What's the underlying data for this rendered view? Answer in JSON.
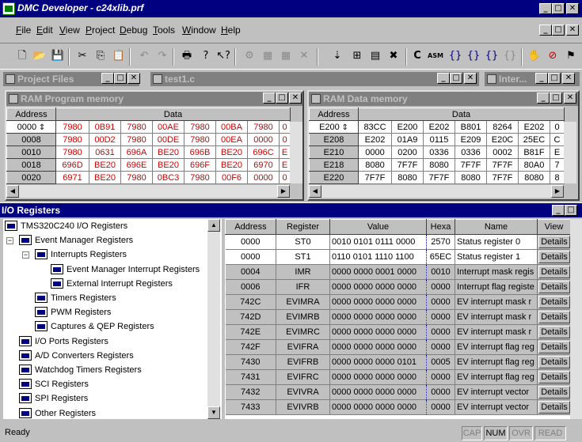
{
  "window": {
    "title": "DMC Developer - c24xlib.prf"
  },
  "menu": [
    "File",
    "Edit",
    "View",
    "Project",
    "Debug",
    "Tools",
    "Window",
    "Help"
  ],
  "toolbar": {
    "c_label": "C",
    "asm_label": "ASM"
  },
  "panes": {
    "project_files": "Project Files",
    "test": "test1.c",
    "inter": "Inter..."
  },
  "program_memory": {
    "title": "RAM Program memory",
    "headers": {
      "address": "Address",
      "data": "Data"
    },
    "addr_input": "0000",
    "rows": [
      {
        "addr": "",
        "vals": [
          "7980",
          "0B91",
          "7980",
          "00AE",
          "7980",
          "00BA",
          "7980",
          "0"
        ]
      },
      {
        "addr": "0008",
        "vals": [
          "7980",
          "00D2",
          "7980",
          "00DE",
          "7980",
          "00EA",
          "0000",
          "0"
        ]
      },
      {
        "addr": "0010",
        "vals": [
          "7980",
          "0631",
          "696A",
          "BE20",
          "696B",
          "BE20",
          "696C",
          "E"
        ]
      },
      {
        "addr": "0018",
        "vals": [
          "696D",
          "BE20",
          "696E",
          "BE20",
          "696F",
          "BE20",
          "6970",
          "E"
        ]
      },
      {
        "addr": "0020",
        "vals": [
          "6971",
          "BE20",
          "7980",
          "0BC3",
          "7980",
          "00F6",
          "0000",
          "0"
        ]
      }
    ]
  },
  "data_memory": {
    "title": "RAM Data memory",
    "headers": {
      "address": "Address",
      "data": "Data"
    },
    "addr_input": "E200",
    "rows": [
      {
        "addr": "",
        "vals": [
          "83CC",
          "E200",
          "E202",
          "B801",
          "8264",
          "E202",
          "0"
        ]
      },
      {
        "addr": "E208",
        "vals": [
          "E202",
          "01A9",
          "0115",
          "E209",
          "E20C",
          "25EC",
          "C"
        ]
      },
      {
        "addr": "E210",
        "vals": [
          "0000",
          "0200",
          "0336",
          "0336",
          "0002",
          "B81F",
          "E"
        ]
      },
      {
        "addr": "E218",
        "vals": [
          "8080",
          "7F7F",
          "8080",
          "7F7F",
          "7F7F",
          "80A0",
          "7"
        ]
      },
      {
        "addr": "E220",
        "vals": [
          "7F7F",
          "8080",
          "7F7F",
          "8080",
          "7F7F",
          "8080",
          "8"
        ]
      }
    ]
  },
  "io": {
    "title": "I/O Registers",
    "tree": [
      {
        "label": "TMS320C240 I/O Registers",
        "level": 0
      },
      {
        "label": "Event Manager Registers",
        "level": 1
      },
      {
        "label": "Interrupts Registers",
        "level": 2
      },
      {
        "label": "Event Manager Interrupt Registers",
        "level": 3
      },
      {
        "label": "External Interrupt Registers",
        "level": 3
      },
      {
        "label": "Timers Registers",
        "level": 2
      },
      {
        "label": "PWM Registers",
        "level": 2
      },
      {
        "label": "Captures & QEP Registers",
        "level": 2
      },
      {
        "label": "I/O Ports Registers",
        "level": 1
      },
      {
        "label": "A/D Converters Registers",
        "level": 1
      },
      {
        "label": "Watchdog Timers Registers",
        "level": 1
      },
      {
        "label": "SCI Registers",
        "level": 1
      },
      {
        "label": "SPI Registers",
        "level": 1
      },
      {
        "label": "Other Registers",
        "level": 1
      }
    ],
    "headers": {
      "address": "Address",
      "register": "Register",
      "value": "Value",
      "hexa": "Hexa",
      "name": "Name",
      "view": "View"
    },
    "details_label": "Details",
    "rows": [
      {
        "address": "0000",
        "register": "ST0",
        "value": "0010 0101 0111 0000",
        "hexa": "2570",
        "name": "Status register 0"
      },
      {
        "address": "0000",
        "register": "ST1",
        "value": "0110 0101 1110 1100",
        "hexa": "65EC",
        "name": "Status register 1"
      },
      {
        "address": "0004",
        "register": "IMR",
        "value": "0000 0000 0001 0000",
        "hexa": "0010",
        "name": "Interrupt mask regis"
      },
      {
        "address": "0006",
        "register": "IFR",
        "value": "0000 0000 0000 0000",
        "hexa": "0000",
        "name": "Interrupt flag registe"
      },
      {
        "address": "742C",
        "register": "EVIMRA",
        "value": "0000 0000 0000 0000",
        "hexa": "0000",
        "name": "EV interrupt mask r"
      },
      {
        "address": "742D",
        "register": "EVIMRB",
        "value": "0000 0000 0000 0000",
        "hexa": "0000",
        "name": "EV interrupt mask r"
      },
      {
        "address": "742E",
        "register": "EVIMRC",
        "value": "0000 0000 0000 0000",
        "hexa": "0000",
        "name": "EV interrupt mask r"
      },
      {
        "address": "742F",
        "register": "EVIFRA",
        "value": "0000 0000 0000 0000",
        "hexa": "0000",
        "name": "EV interrupt flag reg"
      },
      {
        "address": "7430",
        "register": "EVIFRB",
        "value": "0000 0000 0000 0101",
        "hexa": "0005",
        "name": "EV interrupt flag reg"
      },
      {
        "address": "7431",
        "register": "EVIFRC",
        "value": "0000 0000 0000 0000",
        "hexa": "0000",
        "name": "EV interrupt flag reg"
      },
      {
        "address": "7432",
        "register": "EVIVRA",
        "value": "0000 0000 0000 0000",
        "hexa": "0000",
        "name": "EV interrupt vector"
      },
      {
        "address": "7433",
        "register": "EVIVRB",
        "value": "0000 0000 0000 0000",
        "hexa": "0000",
        "name": "EV interrupt vector"
      }
    ]
  },
  "status": {
    "text": "Ready",
    "cap": "CAP",
    "num": "NUM",
    "ovr": "OVR",
    "read": "READ"
  }
}
